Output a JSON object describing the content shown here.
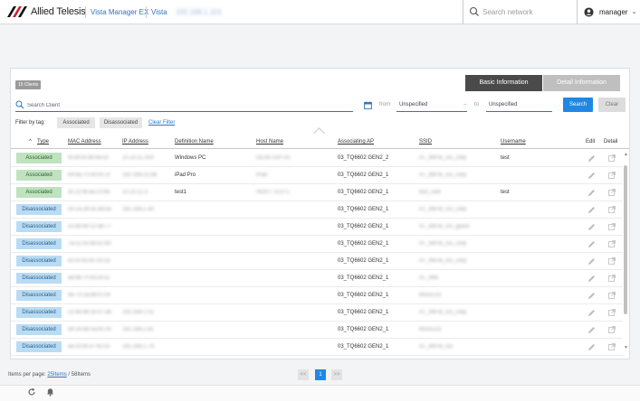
{
  "topbar": {
    "brand": "Allied Telesis",
    "product": "Vista Manager EX",
    "section": "Vista",
    "address": "192.168.1.101",
    "search_placeholder": "Search network",
    "user": "manager"
  },
  "panel": {
    "client_count": "15 Clients",
    "tabs": [
      "Basic Information",
      "Detail Information"
    ],
    "search_placeholder": "Search Client",
    "from_label": "from",
    "from_value": "Unspecified",
    "dash": "–",
    "to_label": "to",
    "to_value": "Unspecified",
    "search_btn": "Search",
    "clear_btn": "Clear",
    "filter_label": "Filter by tag:",
    "filter_chips": [
      "Associated",
      "Disassociated"
    ],
    "clear_filter": "Clear Filter",
    "columns": {
      "type": "Type",
      "mac": "MAC Address",
      "ip": "IP Address",
      "definition": "Definition Name",
      "host": "Host Name",
      "ap": "Associating AP",
      "ssid": "SSID",
      "username": "Username",
      "edit": "Edit",
      "detail": "Detail"
    },
    "sort_indicator": "^",
    "rows": [
      {
        "type": "Associated",
        "status": "assoc",
        "mac": "f8:a4:5f:3b:9a:c0",
        "ip": "10.10.11.100",
        "def": "Windows PC",
        "host": "DESKTOP-A1",
        "ap": "03_TQ6602 GEN2_2",
        "ssid": "AT_WiFi6_5G_corp",
        "user": "test"
      },
      {
        "type": "Associated",
        "status": "assoc",
        "mac": "b4:6a:7c:0e:91:2f",
        "ip": "192.168.22.88",
        "def": "iPad Pro",
        "host": "iPad",
        "ap": "03_TQ6602 GEN2_1",
        "ssid": "AT_WiFi6_5G_corp",
        "user": ""
      },
      {
        "type": "Associated",
        "status": "assoc",
        "mac": "3c:22:fb:aa:10:6e",
        "ip": "10.10.11.3",
        "def": "test1",
        "host": "HOST-TEST1",
        "ap": "03_TQ6602 GEN2_1",
        "ssid": "test_ssid",
        "user": "test"
      },
      {
        "type": "Disassociated",
        "status": "disassoc",
        "mac": "00:1a:2b:3c:4d:5e",
        "ip": "192.168.1.40",
        "def": "",
        "host": "",
        "ap": "03_TQ6602 GEN2_1",
        "ssid": "AT_WiFi6_5G_corp",
        "user": ""
      },
      {
        "type": "Disassociated",
        "status": "disassoc",
        "mac": "5c:8d:4e:12:ab:77",
        "ip": "",
        "def": "",
        "host": "",
        "ap": "03_TQ6602 GEN2_1",
        "ssid": "AT_WiFi6_5G_guest",
        "user": ""
      },
      {
        "type": "Disassociated",
        "status": "disassoc",
        "mac": "7a:11:0c:6b:e2:90",
        "ip": "",
        "def": "",
        "host": "",
        "ap": "03_TQ6602 GEN2_1",
        "ssid": "AT_WiFi6_5G_corp",
        "user": ""
      },
      {
        "type": "Disassociated",
        "status": "disassoc",
        "mac": "e0:5f:45:9c:33:1d",
        "ip": "",
        "def": "",
        "host": "",
        "ap": "03_TQ6602 GEN2_1",
        "ssid": "AT_WiFi6_5G_corp",
        "user": ""
      },
      {
        "type": "Disassociated",
        "status": "disassoc",
        "mac": "a8:66:7f:0d:c4:52",
        "ip": "",
        "def": "",
        "host": "",
        "ap": "03_TQ6602 GEN2_1",
        "ssid": "AT_Wi6",
        "user": ""
      },
      {
        "type": "Disassociated",
        "status": "disassoc",
        "mac": "9e:73:2a:88:f1:04",
        "ip": "",
        "def": "",
        "host": "",
        "ap": "03_TQ6602 GEN2_1",
        "ssid": "MSDLO2",
        "user": ""
      },
      {
        "type": "Disassociated",
        "status": "disassoc",
        "mac": "c2:4b:9d:1e:07:a6",
        "ip": "192.168.1.52",
        "def": "",
        "host": "",
        "ap": "03_TQ6602 GEN2_1",
        "ssid": "AT_WiFi6_5G_corp",
        "user": ""
      },
      {
        "type": "Disassociated",
        "status": "disassoc",
        "mac": "d4:19:e8:5a:6c:30",
        "ip": "192.168.1.61",
        "def": "",
        "host": "",
        "ap": "03_TQ6602 GEN2_1",
        "ssid": "MSDLO2",
        "user": ""
      },
      {
        "type": "Disassociated",
        "status": "disassoc",
        "mac": "ae:20:bf:37:92:c5",
        "ip": "192.168.1.74",
        "def": "",
        "host": "",
        "ap": "03_TQ6602 GEN2_1",
        "ssid": "AT_WiFi6_5G",
        "user": ""
      }
    ]
  },
  "footer": {
    "items_label": "Items per page: ",
    "items_link": "25Items",
    "items_total": " / 58Items",
    "prev": "<<",
    "page": "1",
    "next": ">>"
  },
  "icons": [
    "allied-telesis-logo",
    "search-icon",
    "user-avatar-icon",
    "chevron-down-icon",
    "calendar-icon",
    "pencil-icon",
    "open-detail-icon",
    "refresh-icon",
    "bell-icon"
  ],
  "colors": {
    "accent": "#1f88e5",
    "associated": "#bfe3bf",
    "disassociated": "#b9dcf4",
    "active_tab": "#4a4a4a"
  }
}
